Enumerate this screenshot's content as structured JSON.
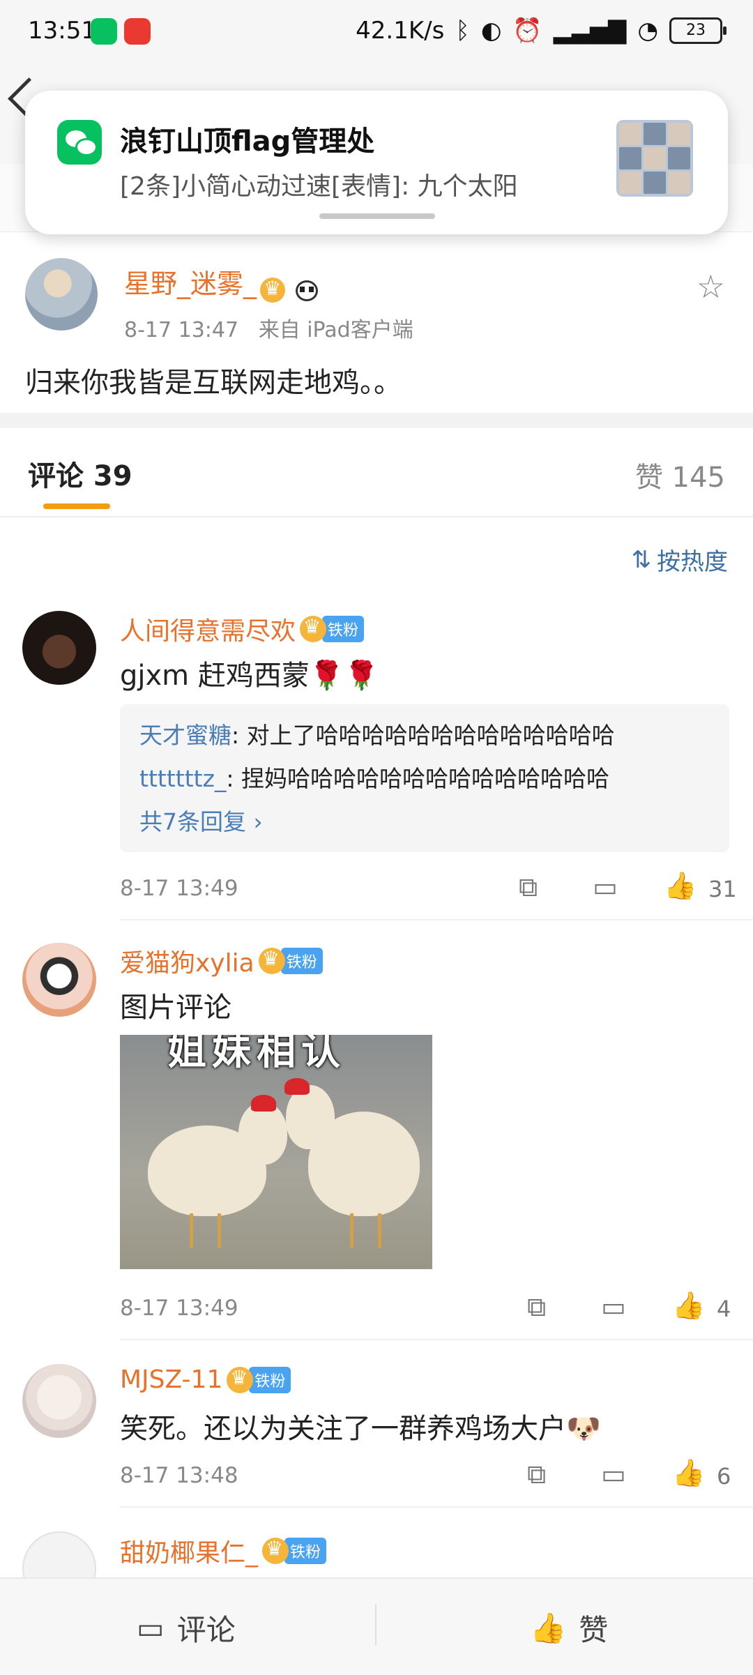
{
  "status_bar": {
    "time": "13:51",
    "net_speed": "42.1K/s",
    "battery": "23",
    "icons": [
      "wechat-icon",
      "netease-music-icon",
      "bluetooth-icon",
      "toggle-icon",
      "alarm-icon",
      "signal-icon",
      "wifi-icon",
      "battery-icon"
    ]
  },
  "notification": {
    "app_icon": "wechat-icon",
    "title": "浪钉山顶flag管理处",
    "body": "[2条]小简心动过速[表情]: 九个太阳"
  },
  "post": {
    "username": "星野_迷雾_",
    "time": "8-17 13:47",
    "source": "来自 iPad客户端",
    "text": "归来你我皆是互联网走地鸡。。"
  },
  "tabs": {
    "comments_label": "评论 39",
    "likes_label": "赞 145"
  },
  "sort_label": "按热度",
  "comments": [
    {
      "username": "人间得意需尽欢",
      "badge": "铁粉",
      "text": "gjxm 赶鸡西蒙🌹🌹",
      "replies": [
        {
          "user": "天才蜜糖",
          "text": ": 对上了哈哈哈哈哈哈哈哈哈哈哈哈哈"
        },
        {
          "user": "tttttttz_",
          "text": ": 捏妈哈哈哈哈哈哈哈哈哈哈哈哈哈哈"
        }
      ],
      "more_replies": "共7条回复 ›",
      "time": "8-17 13:49",
      "likes": "31"
    },
    {
      "username": "爱猫狗xylia",
      "badge": "铁粉",
      "text": "图片评论",
      "image_caption": "姐妹相认",
      "time": "8-17 13:49",
      "likes": "4"
    },
    {
      "username": "MJSZ-11",
      "badge": "铁粉",
      "text": "笑死。还以为关注了一群养鸡场大户🐶",
      "time": "8-17 13:48",
      "likes": "6"
    },
    {
      "username": "甜奶椰果仁_",
      "badge": "铁粉"
    }
  ],
  "bottom_bar": {
    "comment_label": "评论",
    "like_label": "赞"
  }
}
